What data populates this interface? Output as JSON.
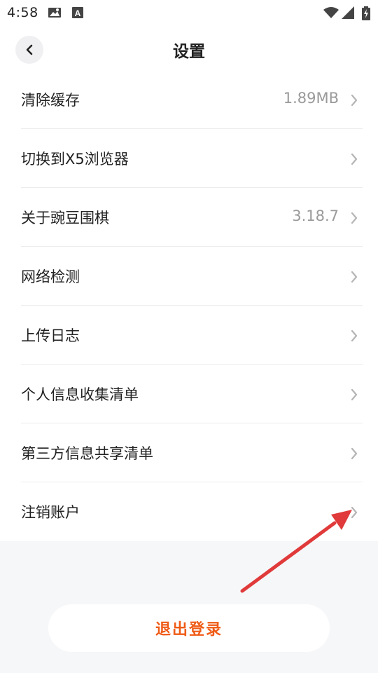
{
  "status_bar": {
    "time": "4:58",
    "left_icons": [
      "gallery-icon",
      "keyboard-a-icon"
    ],
    "right_icons": [
      "wifi-icon",
      "signal-icon",
      "battery-charging-icon"
    ]
  },
  "header": {
    "title": "设置",
    "back_icon": "chevron-left-icon"
  },
  "settings": {
    "items": [
      {
        "label": "清除缓存",
        "value": "1.89MB"
      },
      {
        "label": "切换到X5浏览器",
        "value": ""
      },
      {
        "label": "关于豌豆围棋",
        "value": "3.18.7"
      },
      {
        "label": "网络检测",
        "value": ""
      },
      {
        "label": "上传日志",
        "value": ""
      },
      {
        "label": "个人信息收集清单",
        "value": ""
      },
      {
        "label": "第三方信息共享清单",
        "value": ""
      },
      {
        "label": "注销账户",
        "value": ""
      }
    ]
  },
  "logout": {
    "label": "退出登录"
  },
  "colors": {
    "accent": "#ef5b16",
    "annotation_arrow": "#e03a3a",
    "background": "#f6f7f9",
    "value_text": "#9a9a9a"
  }
}
